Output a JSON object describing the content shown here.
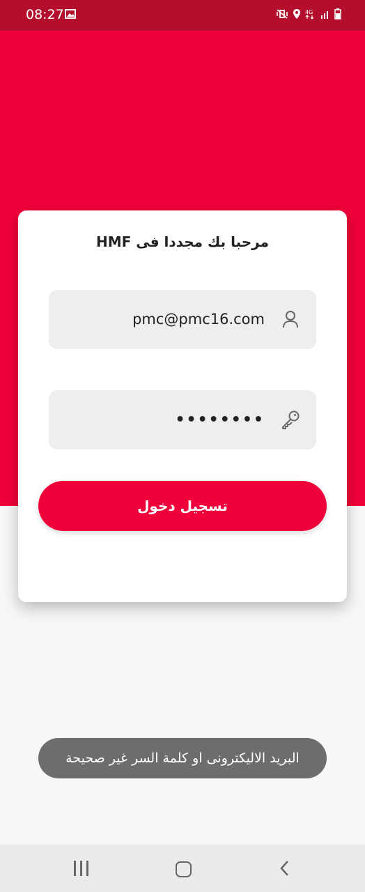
{
  "status_bar": {
    "time": "08:27",
    "icons": [
      "image-icon",
      "mute-vibrate-icon",
      "location-icon",
      "4g-icon",
      "signal-icon",
      "battery-icon"
    ]
  },
  "colors": {
    "accent": "#f0003a",
    "status_bar": "#b30f2c",
    "toast": "#6d6d6d",
    "field_bg": "#eeeeee"
  },
  "login": {
    "title": "مرحبا بك مجددا فى HMF",
    "email_value": "pmc@pmc16.com",
    "password_value": "••••••••",
    "login_button": "تسجيل دخول"
  },
  "toast": {
    "message": "البريد الاليكترونى او كلمة السر غير صحيحة"
  },
  "nav_bar": {
    "icons": [
      "recents-icon",
      "home-icon",
      "back-icon"
    ]
  }
}
